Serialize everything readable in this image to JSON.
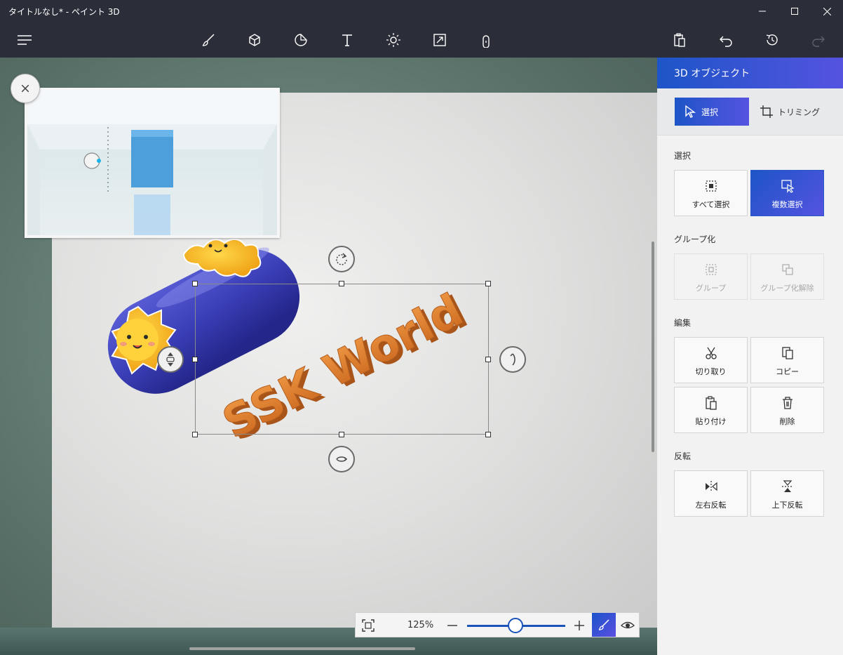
{
  "window": {
    "title": "タイトルなし* - ペイント 3D",
    "controls": [
      "minimize",
      "maximize",
      "close"
    ]
  },
  "toolbar": {
    "left": [
      "menu-icon"
    ],
    "tools": [
      "brushes-icon",
      "3d-shapes-icon",
      "stickers-icon",
      "text-icon",
      "effects-icon",
      "canvas-icon",
      "3d-library-icon"
    ],
    "right": [
      "paste-icon",
      "undo-icon",
      "history-icon",
      "redo-icon"
    ]
  },
  "canvas": {
    "object_text": "SSK World",
    "zoom": {
      "percent": "125%",
      "level": 0.55
    }
  },
  "panel": {
    "header": "3D オブジェクト",
    "modes": {
      "select": "選択",
      "trim": "トリミング"
    },
    "sections": {
      "select": {
        "title": "選択",
        "all": "すべて選択",
        "multi": "複数選択"
      },
      "group": {
        "title": "グループ化",
        "group": "グループ",
        "ungroup": "グループ化解除"
      },
      "edit": {
        "title": "編集",
        "cut": "切り取り",
        "copy": "コピー",
        "paste": "貼り付け",
        "delete": "削除"
      },
      "flip": {
        "title": "反転",
        "horizontal": "左右反転",
        "vertical": "上下反転"
      }
    }
  },
  "colors": {
    "accent_start": "#1d55c7",
    "accent_end": "#5553e0",
    "text_orange": "#e07a2a",
    "capsule_blue": "#3b3fb8"
  }
}
